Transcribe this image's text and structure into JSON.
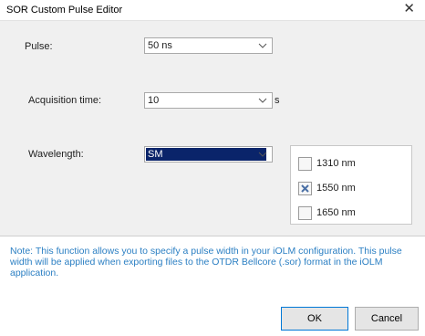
{
  "window": {
    "title": "SOR Custom Pulse Editor",
    "close": "✕"
  },
  "pulse": {
    "label": "Pulse:",
    "value": "50 ns"
  },
  "acquisition": {
    "label": "Acquisition time:",
    "value": "10",
    "unit": "s"
  },
  "wavelength": {
    "label": "Wavelength:",
    "value": "SM",
    "options": [
      {
        "label": "1310 nm",
        "checked": false
      },
      {
        "label": "1550 nm",
        "checked": true
      },
      {
        "label": "1650 nm",
        "checked": false
      }
    ]
  },
  "note": "Note: This function allows you to specify a pulse width in your iOLM configuration. This pulse width will be applied when exporting files to the OTDR Bellcore (.sor) format in the iOLM application.",
  "buttons": {
    "ok": "OK",
    "cancel": "Cancel"
  },
  "colors": {
    "note_text": "#2b7fc3",
    "selection": "#0a246a",
    "check_mark": "#4a6fa5"
  }
}
